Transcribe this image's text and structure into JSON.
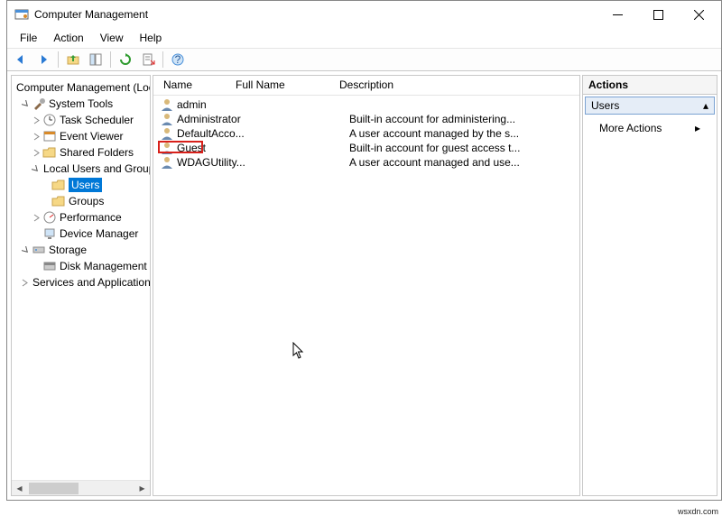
{
  "window": {
    "title": "Computer Management"
  },
  "menu": {
    "file": "File",
    "action": "Action",
    "view": "View",
    "help": "Help"
  },
  "tree": {
    "root": "Computer Management (Local",
    "systools": "System Tools",
    "task": "Task Scheduler",
    "event": "Event Viewer",
    "shared": "Shared Folders",
    "lug": "Local Users and Groups",
    "users": "Users",
    "groups": "Groups",
    "perf": "Performance",
    "devmgr": "Device Manager",
    "storage": "Storage",
    "diskmgmt": "Disk Management",
    "svcapp": "Services and Applications"
  },
  "list": {
    "columns": {
      "name": "Name",
      "full": "Full Name",
      "desc": "Description"
    },
    "rows": [
      {
        "name": "admin",
        "full": "",
        "desc": ""
      },
      {
        "name": "Administrator",
        "full": "",
        "desc": "Built-in account for administering..."
      },
      {
        "name": "DefaultAcco...",
        "full": "",
        "desc": "A user account managed by the s..."
      },
      {
        "name": "Guest",
        "full": "",
        "desc": "Built-in account for guest access t..."
      },
      {
        "name": "WDAGUtility...",
        "full": "",
        "desc": "A user account managed and use..."
      }
    ]
  },
  "actions": {
    "header": "Actions",
    "section": "Users",
    "more": "More Actions"
  },
  "footer": "wsxdn.com"
}
